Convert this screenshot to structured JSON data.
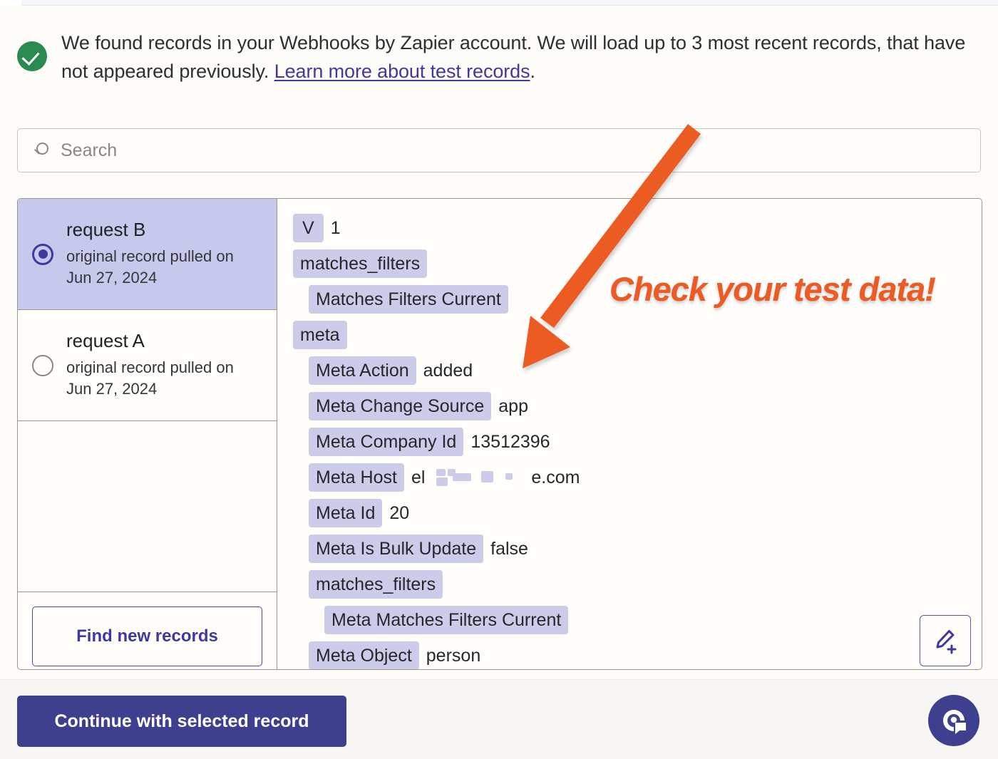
{
  "banner": {
    "icon": "check-circle-icon",
    "text_before": "We found records in your Webhooks by Zapier account. We will load up to 3 most recent records, that have not appeared previously. ",
    "link_text": "Learn more about test records",
    "text_after": "."
  },
  "search": {
    "icon": "search-icon",
    "placeholder": "Search",
    "value": ""
  },
  "records": {
    "items": [
      {
        "label": "request B",
        "sub": "original record pulled on Jun 27, 2024",
        "selected": true
      },
      {
        "label": "request A",
        "sub": "original record pulled on Jun 27, 2024",
        "selected": false
      }
    ],
    "find_new_records_label": "Find new records"
  },
  "data_panel": {
    "rows": [
      {
        "key": "V",
        "value": "1",
        "indent": 0,
        "value_kind": "text"
      },
      {
        "key": "matches_filters",
        "value": "",
        "indent": 0,
        "value_kind": "none"
      },
      {
        "key": "Matches Filters Current",
        "value": "",
        "indent": 1,
        "value_kind": "none"
      },
      {
        "key": "meta",
        "value": "",
        "indent": 0,
        "value_kind": "none"
      },
      {
        "key": "Meta Action",
        "value": "added",
        "indent": 1,
        "value_kind": "text"
      },
      {
        "key": "Meta Change Source",
        "value": "app",
        "indent": 1,
        "value_kind": "text"
      },
      {
        "key": "Meta Company Id",
        "value": "13512396",
        "indent": 1,
        "value_kind": "text"
      },
      {
        "key": "Meta Host",
        "value": "el",
        "value_suffix": "e.com",
        "indent": 1,
        "value_kind": "redacted"
      },
      {
        "key": "Meta Id",
        "value": "20",
        "indent": 1,
        "value_kind": "text"
      },
      {
        "key": "Meta Is Bulk Update",
        "value": "false",
        "indent": 1,
        "value_kind": "text"
      },
      {
        "key": "matches_filters",
        "value": "",
        "indent": 1,
        "value_kind": "none"
      },
      {
        "key": "Meta Matches Filters Current",
        "value": "",
        "indent": 2,
        "value_kind": "none"
      },
      {
        "key": "Meta Object",
        "value": "person",
        "indent": 1,
        "value_kind": "text"
      }
    ],
    "edit_icon": "pencil-plus-icon"
  },
  "annotation": {
    "text": "Check your test data!",
    "color": "#ec5b24",
    "arrow_icon": "arrow-down-left-icon"
  },
  "footer": {
    "continue_label": "Continue with selected record",
    "support_icon": "support-chat-icon"
  },
  "colors": {
    "accent_purple": "#3f399e",
    "chip_lavender": "#ccccea",
    "selected_row": "#c7c9ec",
    "success_green": "#2a8a4f",
    "annotation_orange": "#ec5b24",
    "page_background": "#fdfcf8"
  }
}
